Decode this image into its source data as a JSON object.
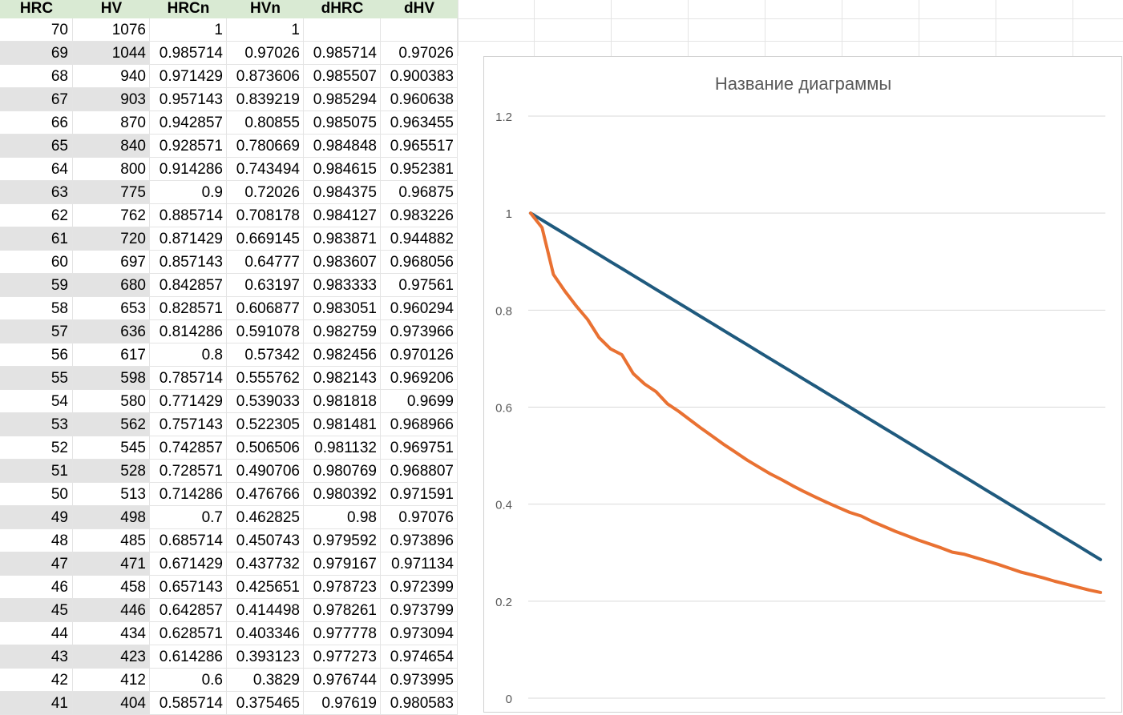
{
  "sheet": {
    "columns": [
      "HRC",
      "HV",
      "HRCn",
      "HVn",
      "dHRC",
      "dHV"
    ],
    "rows": [
      [
        "70",
        "1076",
        "1",
        "1",
        "",
        ""
      ],
      [
        "69",
        "1044",
        "0.985714",
        "0.97026",
        "0.985714",
        "0.97026"
      ],
      [
        "68",
        "940",
        "0.971429",
        "0.873606",
        "0.985507",
        "0.900383"
      ],
      [
        "67",
        "903",
        "0.957143",
        "0.839219",
        "0.985294",
        "0.960638"
      ],
      [
        "66",
        "870",
        "0.942857",
        "0.80855",
        "0.985075",
        "0.963455"
      ],
      [
        "65",
        "840",
        "0.928571",
        "0.780669",
        "0.984848",
        "0.965517"
      ],
      [
        "64",
        "800",
        "0.914286",
        "0.743494",
        "0.984615",
        "0.952381"
      ],
      [
        "63",
        "775",
        "0.9",
        "0.72026",
        "0.984375",
        "0.96875"
      ],
      [
        "62",
        "762",
        "0.885714",
        "0.708178",
        "0.984127",
        "0.983226"
      ],
      [
        "61",
        "720",
        "0.871429",
        "0.669145",
        "0.983871",
        "0.944882"
      ],
      [
        "60",
        "697",
        "0.857143",
        "0.64777",
        "0.983607",
        "0.968056"
      ],
      [
        "59",
        "680",
        "0.842857",
        "0.63197",
        "0.983333",
        "0.97561"
      ],
      [
        "58",
        "653",
        "0.828571",
        "0.606877",
        "0.983051",
        "0.960294"
      ],
      [
        "57",
        "636",
        "0.814286",
        "0.591078",
        "0.982759",
        "0.973966"
      ],
      [
        "56",
        "617",
        "0.8",
        "0.57342",
        "0.982456",
        "0.970126"
      ],
      [
        "55",
        "598",
        "0.785714",
        "0.555762",
        "0.982143",
        "0.969206"
      ],
      [
        "54",
        "580",
        "0.771429",
        "0.539033",
        "0.981818",
        "0.9699"
      ],
      [
        "53",
        "562",
        "0.757143",
        "0.522305",
        "0.981481",
        "0.968966"
      ],
      [
        "52",
        "545",
        "0.742857",
        "0.506506",
        "0.981132",
        "0.969751"
      ],
      [
        "51",
        "528",
        "0.728571",
        "0.490706",
        "0.980769",
        "0.968807"
      ],
      [
        "50",
        "513",
        "0.714286",
        "0.476766",
        "0.980392",
        "0.971591"
      ],
      [
        "49",
        "498",
        "0.7",
        "0.462825",
        "0.98",
        "0.97076"
      ],
      [
        "48",
        "485",
        "0.685714",
        "0.450743",
        "0.979592",
        "0.973896"
      ],
      [
        "47",
        "471",
        "0.671429",
        "0.437732",
        "0.979167",
        "0.971134"
      ],
      [
        "46",
        "458",
        "0.657143",
        "0.425651",
        "0.978723",
        "0.972399"
      ],
      [
        "45",
        "446",
        "0.642857",
        "0.414498",
        "0.978261",
        "0.973799"
      ],
      [
        "44",
        "434",
        "0.628571",
        "0.403346",
        "0.977778",
        "0.973094"
      ],
      [
        "43",
        "423",
        "0.614286",
        "0.393123",
        "0.977273",
        "0.974654"
      ],
      [
        "42",
        "412",
        "0.6",
        "0.3829",
        "0.976744",
        "0.973995"
      ],
      [
        "41",
        "404",
        "0.585714",
        "0.375465",
        "0.97619",
        "0.980583"
      ]
    ]
  },
  "chart_data": {
    "type": "line",
    "title": "Название диаграммы",
    "xlabel": "",
    "ylabel": "",
    "ylim": [
      0,
      1.2
    ],
    "yticks": [
      "0",
      "0.2",
      "0.4",
      "0.6",
      "0.8",
      "1",
      "1.2"
    ],
    "grid": true,
    "legend": "none",
    "series": [
      {
        "color": "#1f5a7e",
        "values": [
          1,
          0.985714,
          0.971429,
          0.957143,
          0.942857,
          0.928571,
          0.914286,
          0.9,
          0.885714,
          0.871429,
          0.857143,
          0.842857,
          0.828571,
          0.814286,
          0.8,
          0.785714,
          0.771429,
          0.757143,
          0.742857,
          0.728571,
          0.714286,
          0.7,
          0.685714,
          0.671429,
          0.657143,
          0.642857,
          0.628571,
          0.614286,
          0.6,
          0.585714,
          0.571429,
          0.557143,
          0.542857,
          0.528571,
          0.514286,
          0.5,
          0.485714,
          0.471429,
          0.457143,
          0.442857,
          0.428571,
          0.414286,
          0.4,
          0.385714,
          0.371429,
          0.357143,
          0.342857,
          0.328571,
          0.314286,
          0.3,
          0.285714
        ]
      },
      {
        "color": "#e97132",
        "values": [
          1,
          0.97026,
          0.873606,
          0.839219,
          0.80855,
          0.780669,
          0.743494,
          0.72026,
          0.708178,
          0.669145,
          0.64777,
          0.63197,
          0.606877,
          0.591078,
          0.57342,
          0.555762,
          0.539033,
          0.522305,
          0.506506,
          0.490706,
          0.476766,
          0.462825,
          0.450743,
          0.437732,
          0.425651,
          0.414498,
          0.403346,
          0.393123,
          0.3829,
          0.375465,
          0.364,
          0.354,
          0.344,
          0.335,
          0.326,
          0.318,
          0.31,
          0.301,
          0.297,
          0.29,
          0.283,
          0.276,
          0.268,
          0.26,
          0.254,
          0.248,
          0.241,
          0.235,
          0.229,
          0.223,
          0.218
        ]
      }
    ]
  }
}
